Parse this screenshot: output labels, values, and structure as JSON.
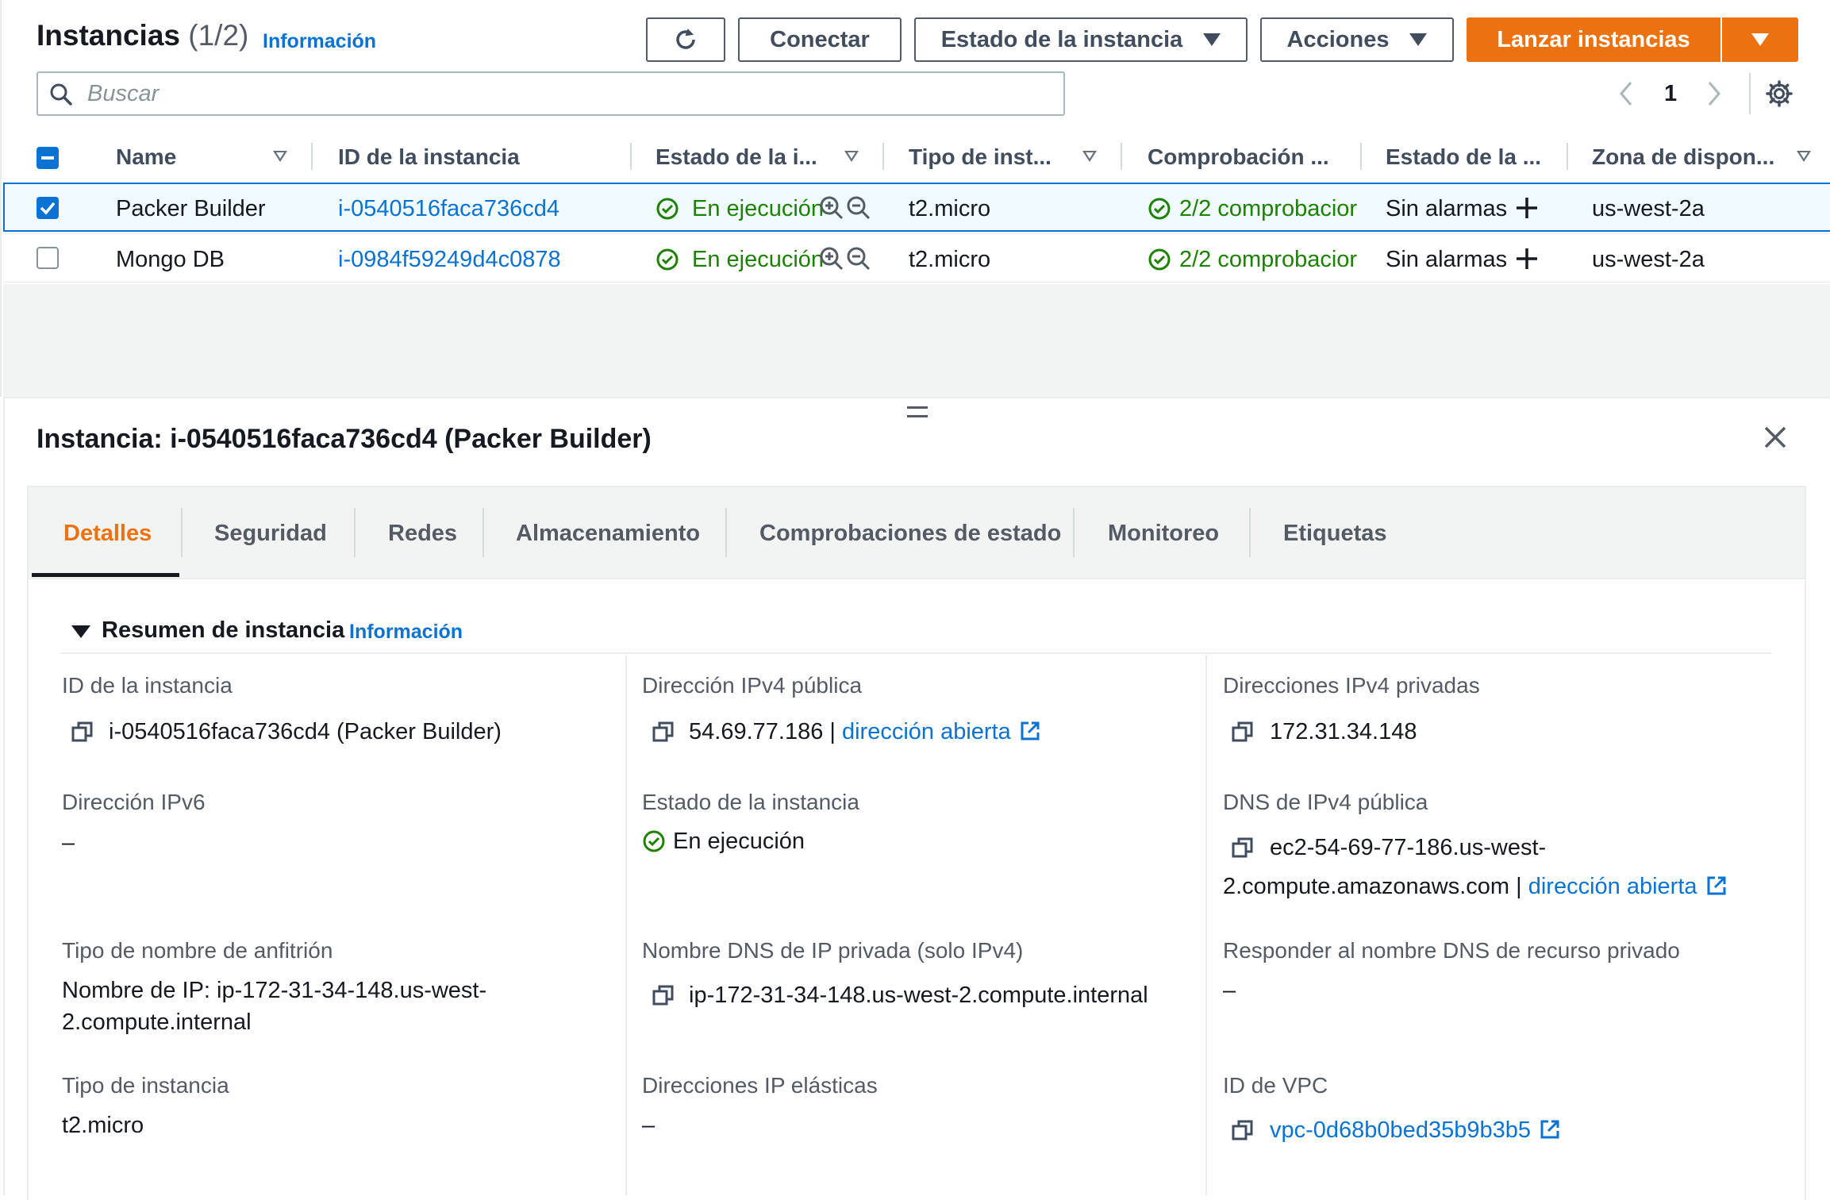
{
  "header": {
    "title": "Instancias",
    "count": "(1/2)",
    "info_link": "Información"
  },
  "toolbar": {
    "refresh_icon": "refresh-icon",
    "connect": "Conectar",
    "instance_state": "Estado de la instancia",
    "actions": "Acciones",
    "launch": "Lanzar instancias"
  },
  "search": {
    "placeholder": "Buscar"
  },
  "pagination": {
    "current_page": "1"
  },
  "table": {
    "columns": [
      "Name",
      "ID de la instancia",
      "Estado de la i...",
      "Tipo de inst...",
      "Comprobación ...",
      "Estado de la ...",
      "Zona de dispon..."
    ],
    "rows": [
      {
        "selected": true,
        "name": "Packer Builder",
        "id": "i-0540516faca736cd4",
        "state": "En ejecución",
        "type": "t2.micro",
        "checks": "2/2 comprobacior",
        "alarms": "Sin alarmas",
        "zone": "us-west-2a"
      },
      {
        "selected": false,
        "name": "Mongo DB",
        "id": "i-0984f59249d4c0878",
        "state": "En ejecución",
        "type": "t2.micro",
        "checks": "2/2 comprobacior",
        "alarms": "Sin alarmas",
        "zone": "us-west-2a"
      }
    ]
  },
  "details": {
    "title": "Instancia: i-0540516faca736cd4 (Packer Builder)",
    "tabs": [
      "Detalles",
      "Seguridad",
      "Redes",
      "Almacenamiento",
      "Comprobaciones de estado",
      "Monitoreo",
      "Etiquetas"
    ],
    "active_tab": "Detalles",
    "summary_heading": "Resumen de instancia",
    "summary_info": "Información",
    "fields": {
      "instance_id_label": "ID de la instancia",
      "instance_id_value": "i-0540516faca736cd4 (Packer Builder)",
      "public_ipv4_label": "Dirección IPv4 pública",
      "public_ipv4_value": "54.69.77.186",
      "open_address": "dirección abierta",
      "private_ipv4_label": "Direcciones IPv4 privadas",
      "private_ipv4_value": "172.31.34.148",
      "ipv6_label": "Dirección IPv6",
      "ipv6_value": "–",
      "state_label": "Estado de la instancia",
      "state_value": "En ejecución",
      "public_dns_label": "DNS de IPv4 pública",
      "public_dns_value_line1": "ec2-54-69-77-186.us-west-",
      "public_dns_value_line2": "2.compute.amazonaws.com",
      "hostname_type_label": "Tipo de nombre de anfitrión",
      "hostname_type_line1": "Nombre de IP: ip-172-31-34-148.us-west-",
      "hostname_type_line2": "2.compute.internal",
      "private_dns_label": "Nombre DNS de IP privada (solo IPv4)",
      "private_dns_value": "ip-172-31-34-148.us-west-2.compute.internal",
      "private_dns_answer_label": "Responder al nombre DNS de recurso privado",
      "private_dns_answer_value": "–",
      "instance_type_label": "Tipo de instancia",
      "instance_type_value": "t2.micro",
      "elastic_ip_label": "Direcciones IP elásticas",
      "elastic_ip_value": "–",
      "vpc_label": "ID de VPC",
      "vpc_value": "vpc-0d68b0bed35b9b3b5"
    }
  },
  "colors": {
    "accent": "#ec7211",
    "link": "#0972d3",
    "success": "#1d8102",
    "text": "#16191f"
  }
}
